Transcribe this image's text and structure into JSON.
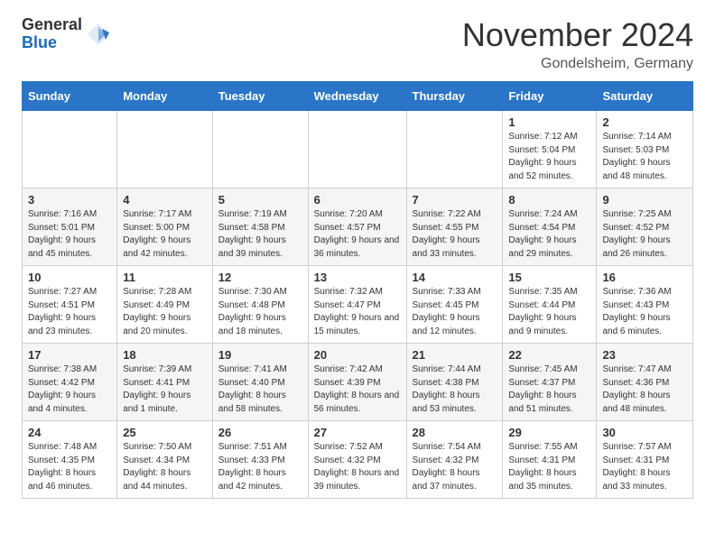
{
  "header": {
    "logo_general": "General",
    "logo_blue": "Blue",
    "month_title": "November 2024",
    "location": "Gondelsheim, Germany"
  },
  "calendar": {
    "days_of_week": [
      "Sunday",
      "Monday",
      "Tuesday",
      "Wednesday",
      "Thursday",
      "Friday",
      "Saturday"
    ],
    "weeks": [
      [
        {
          "day": "",
          "info": ""
        },
        {
          "day": "",
          "info": ""
        },
        {
          "day": "",
          "info": ""
        },
        {
          "day": "",
          "info": ""
        },
        {
          "day": "",
          "info": ""
        },
        {
          "day": "1",
          "info": "Sunrise: 7:12 AM\nSunset: 5:04 PM\nDaylight: 9 hours and 52 minutes."
        },
        {
          "day": "2",
          "info": "Sunrise: 7:14 AM\nSunset: 5:03 PM\nDaylight: 9 hours and 48 minutes."
        }
      ],
      [
        {
          "day": "3",
          "info": "Sunrise: 7:16 AM\nSunset: 5:01 PM\nDaylight: 9 hours and 45 minutes."
        },
        {
          "day": "4",
          "info": "Sunrise: 7:17 AM\nSunset: 5:00 PM\nDaylight: 9 hours and 42 minutes."
        },
        {
          "day": "5",
          "info": "Sunrise: 7:19 AM\nSunset: 4:58 PM\nDaylight: 9 hours and 39 minutes."
        },
        {
          "day": "6",
          "info": "Sunrise: 7:20 AM\nSunset: 4:57 PM\nDaylight: 9 hours and 36 minutes."
        },
        {
          "day": "7",
          "info": "Sunrise: 7:22 AM\nSunset: 4:55 PM\nDaylight: 9 hours and 33 minutes."
        },
        {
          "day": "8",
          "info": "Sunrise: 7:24 AM\nSunset: 4:54 PM\nDaylight: 9 hours and 29 minutes."
        },
        {
          "day": "9",
          "info": "Sunrise: 7:25 AM\nSunset: 4:52 PM\nDaylight: 9 hours and 26 minutes."
        }
      ],
      [
        {
          "day": "10",
          "info": "Sunrise: 7:27 AM\nSunset: 4:51 PM\nDaylight: 9 hours and 23 minutes."
        },
        {
          "day": "11",
          "info": "Sunrise: 7:28 AM\nSunset: 4:49 PM\nDaylight: 9 hours and 20 minutes."
        },
        {
          "day": "12",
          "info": "Sunrise: 7:30 AM\nSunset: 4:48 PM\nDaylight: 9 hours and 18 minutes."
        },
        {
          "day": "13",
          "info": "Sunrise: 7:32 AM\nSunset: 4:47 PM\nDaylight: 9 hours and 15 minutes."
        },
        {
          "day": "14",
          "info": "Sunrise: 7:33 AM\nSunset: 4:45 PM\nDaylight: 9 hours and 12 minutes."
        },
        {
          "day": "15",
          "info": "Sunrise: 7:35 AM\nSunset: 4:44 PM\nDaylight: 9 hours and 9 minutes."
        },
        {
          "day": "16",
          "info": "Sunrise: 7:36 AM\nSunset: 4:43 PM\nDaylight: 9 hours and 6 minutes."
        }
      ],
      [
        {
          "day": "17",
          "info": "Sunrise: 7:38 AM\nSunset: 4:42 PM\nDaylight: 9 hours and 4 minutes."
        },
        {
          "day": "18",
          "info": "Sunrise: 7:39 AM\nSunset: 4:41 PM\nDaylight: 9 hours and 1 minute."
        },
        {
          "day": "19",
          "info": "Sunrise: 7:41 AM\nSunset: 4:40 PM\nDaylight: 8 hours and 58 minutes."
        },
        {
          "day": "20",
          "info": "Sunrise: 7:42 AM\nSunset: 4:39 PM\nDaylight: 8 hours and 56 minutes."
        },
        {
          "day": "21",
          "info": "Sunrise: 7:44 AM\nSunset: 4:38 PM\nDaylight: 8 hours and 53 minutes."
        },
        {
          "day": "22",
          "info": "Sunrise: 7:45 AM\nSunset: 4:37 PM\nDaylight: 8 hours and 51 minutes."
        },
        {
          "day": "23",
          "info": "Sunrise: 7:47 AM\nSunset: 4:36 PM\nDaylight: 8 hours and 48 minutes."
        }
      ],
      [
        {
          "day": "24",
          "info": "Sunrise: 7:48 AM\nSunset: 4:35 PM\nDaylight: 8 hours and 46 minutes."
        },
        {
          "day": "25",
          "info": "Sunrise: 7:50 AM\nSunset: 4:34 PM\nDaylight: 8 hours and 44 minutes."
        },
        {
          "day": "26",
          "info": "Sunrise: 7:51 AM\nSunset: 4:33 PM\nDaylight: 8 hours and 42 minutes."
        },
        {
          "day": "27",
          "info": "Sunrise: 7:52 AM\nSunset: 4:32 PM\nDaylight: 8 hours and 39 minutes."
        },
        {
          "day": "28",
          "info": "Sunrise: 7:54 AM\nSunset: 4:32 PM\nDaylight: 8 hours and 37 minutes."
        },
        {
          "day": "29",
          "info": "Sunrise: 7:55 AM\nSunset: 4:31 PM\nDaylight: 8 hours and 35 minutes."
        },
        {
          "day": "30",
          "info": "Sunrise: 7:57 AM\nSunset: 4:31 PM\nDaylight: 8 hours and 33 minutes."
        }
      ]
    ]
  }
}
